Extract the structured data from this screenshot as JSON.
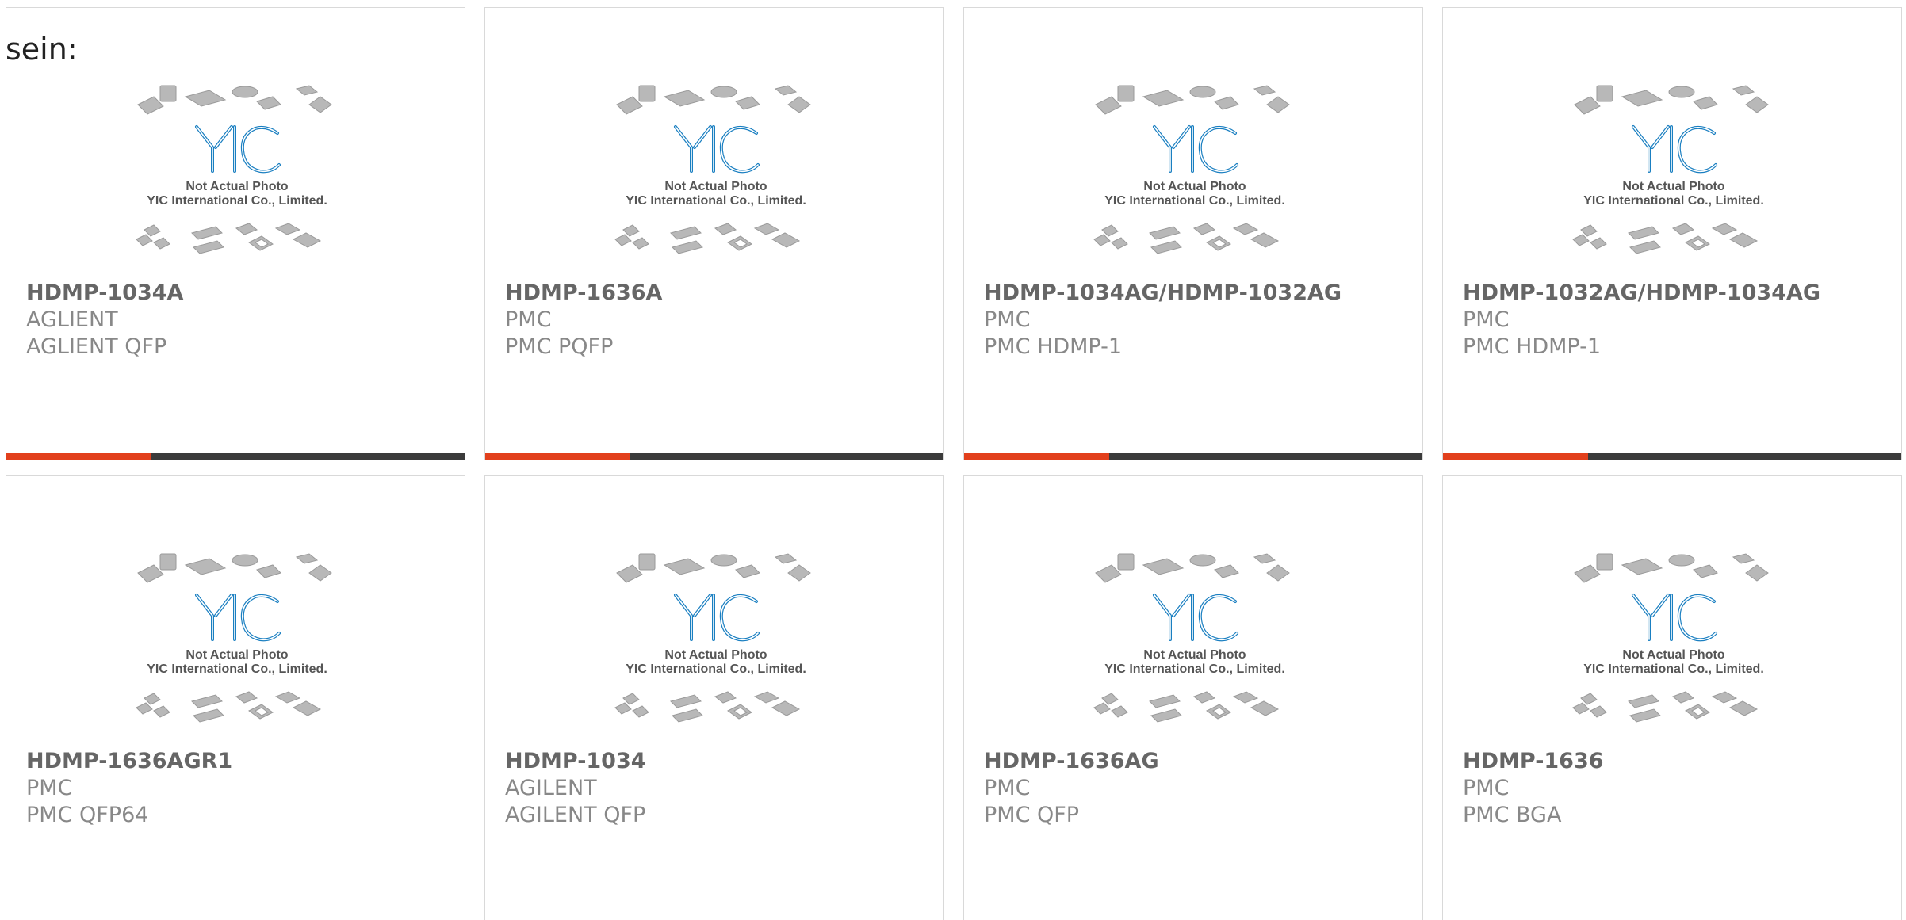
{
  "intro_text": "sein:",
  "placeholder": {
    "caption_line1": "Not Actual Photo",
    "caption_line2": "YIC International Co., Limited.",
    "logo_text": "YIC"
  },
  "colors": {
    "accent_bar": "#e2401c",
    "bar": "#3b3b3b",
    "logo": "#1a7fc1"
  },
  "products": [
    {
      "part": "HDMP-1034A",
      "brand": "AGLIENT",
      "package": "AGLIENT QFP",
      "has_bar": true
    },
    {
      "part": "HDMP-1636A",
      "brand": "PMC",
      "package": "PMC PQFP",
      "has_bar": true
    },
    {
      "part": "HDMP-1034AG/HDMP-1032AG",
      "brand": "PMC",
      "package": "PMC HDMP-1",
      "has_bar": true
    },
    {
      "part": "HDMP-1032AG/HDMP-1034AG",
      "brand": "PMC",
      "package": "PMC HDMP-1",
      "has_bar": true
    },
    {
      "part": "HDMP-1636AGR1",
      "brand": "PMC",
      "package": "PMC QFP64",
      "has_bar": false
    },
    {
      "part": "HDMP-1034",
      "brand": "AGILENT",
      "package": "AGILENT QFP",
      "has_bar": false
    },
    {
      "part": "HDMP-1636AG",
      "brand": "PMC",
      "package": "PMC QFP",
      "has_bar": false
    },
    {
      "part": "HDMP-1636",
      "brand": "PMC",
      "package": "PMC BGA",
      "has_bar": false
    }
  ]
}
